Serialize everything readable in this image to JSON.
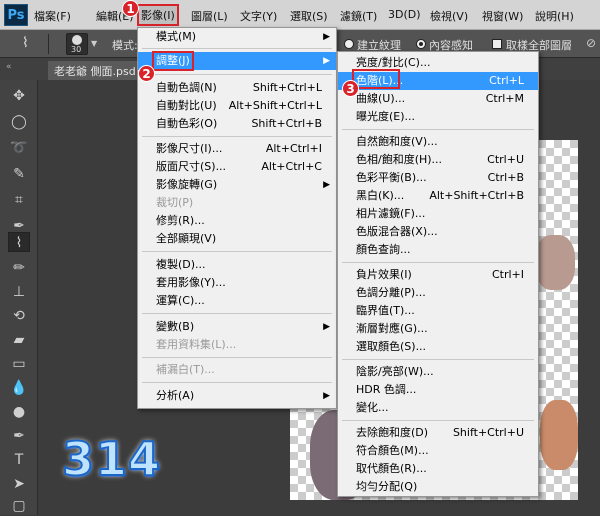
{
  "menubar": {
    "logo": "Ps",
    "items": [
      "檔案(F)",
      "編輯(E)",
      "影像(I)",
      "圖層(L)",
      "文字(Y)",
      "選取(S)",
      "濾鏡(T)",
      "3D(D)",
      "檢視(V)",
      "視窗(W)",
      "說明(H)"
    ]
  },
  "options": {
    "brush_size": "30",
    "mode_label": "模式:",
    "create_texture": "建立紋理",
    "content_aware": "內容感知",
    "sample_all_layers": "取樣全部圖層"
  },
  "doc_tab": "老老爺 側面.psd @",
  "image_menu": {
    "items": [
      {
        "label": "模式(M)",
        "submenu": true
      },
      {
        "label": "調整(J)",
        "submenu": true,
        "highlighted": true
      },
      {
        "label": "自動色調(N)",
        "shortcut": "Shift+Ctrl+L"
      },
      {
        "label": "自動對比(U)",
        "shortcut": "Alt+Shift+Ctrl+L"
      },
      {
        "label": "自動色彩(O)",
        "shortcut": "Shift+Ctrl+B"
      },
      {
        "label": "影像尺寸(I)...",
        "shortcut": "Alt+Ctrl+I"
      },
      {
        "label": "版面尺寸(S)...",
        "shortcut": "Alt+Ctrl+C"
      },
      {
        "label": "影像旋轉(G)",
        "submenu": true
      },
      {
        "label": "裁切(P)",
        "disabled": true
      },
      {
        "label": "修剪(R)..."
      },
      {
        "label": "全部顯現(V)"
      },
      {
        "label": "複製(D)..."
      },
      {
        "label": "套用影像(Y)..."
      },
      {
        "label": "運算(C)..."
      },
      {
        "label": "變數(B)",
        "submenu": true
      },
      {
        "label": "套用資料集(L)...",
        "disabled": true
      },
      {
        "label": "補漏白(T)...",
        "disabled": true
      },
      {
        "label": "分析(A)",
        "submenu": true
      }
    ]
  },
  "adjust_menu": {
    "items": [
      {
        "label": "亮度/對比(C)..."
      },
      {
        "label": "色階(L)...",
        "shortcut": "Ctrl+L",
        "highlighted": true
      },
      {
        "label": "曲線(U)...",
        "shortcut": "Ctrl+M"
      },
      {
        "label": "曝光度(E)..."
      },
      {
        "label": "自然飽和度(V)..."
      },
      {
        "label": "色相/飽和度(H)...",
        "shortcut": "Ctrl+U"
      },
      {
        "label": "色彩平衡(B)...",
        "shortcut": "Ctrl+B"
      },
      {
        "label": "黑白(K)...",
        "shortcut": "Alt+Shift+Ctrl+B"
      },
      {
        "label": "相片濾鏡(F)..."
      },
      {
        "label": "色版混合器(X)..."
      },
      {
        "label": "顏色查詢..."
      },
      {
        "label": "負片效果(I)",
        "shortcut": "Ctrl+I"
      },
      {
        "label": "色調分離(P)..."
      },
      {
        "label": "臨界值(T)..."
      },
      {
        "label": "漸層對應(G)..."
      },
      {
        "label": "選取顏色(S)..."
      },
      {
        "label": "陰影/亮部(W)..."
      },
      {
        "label": "HDR 色調..."
      },
      {
        "label": "變化..."
      },
      {
        "label": "去除飽和度(D)",
        "shortcut": "Shift+Ctrl+U"
      },
      {
        "label": "符合顏色(M)..."
      },
      {
        "label": "取代顏色(R)..."
      },
      {
        "label": "均勻分配(Q)"
      }
    ]
  },
  "callouts": [
    "1",
    "2",
    "3"
  ],
  "watermark": "314",
  "colors": {
    "highlight": "#3399ff",
    "callout": "#d8232a",
    "menu_bg": "#f0f0f0"
  }
}
